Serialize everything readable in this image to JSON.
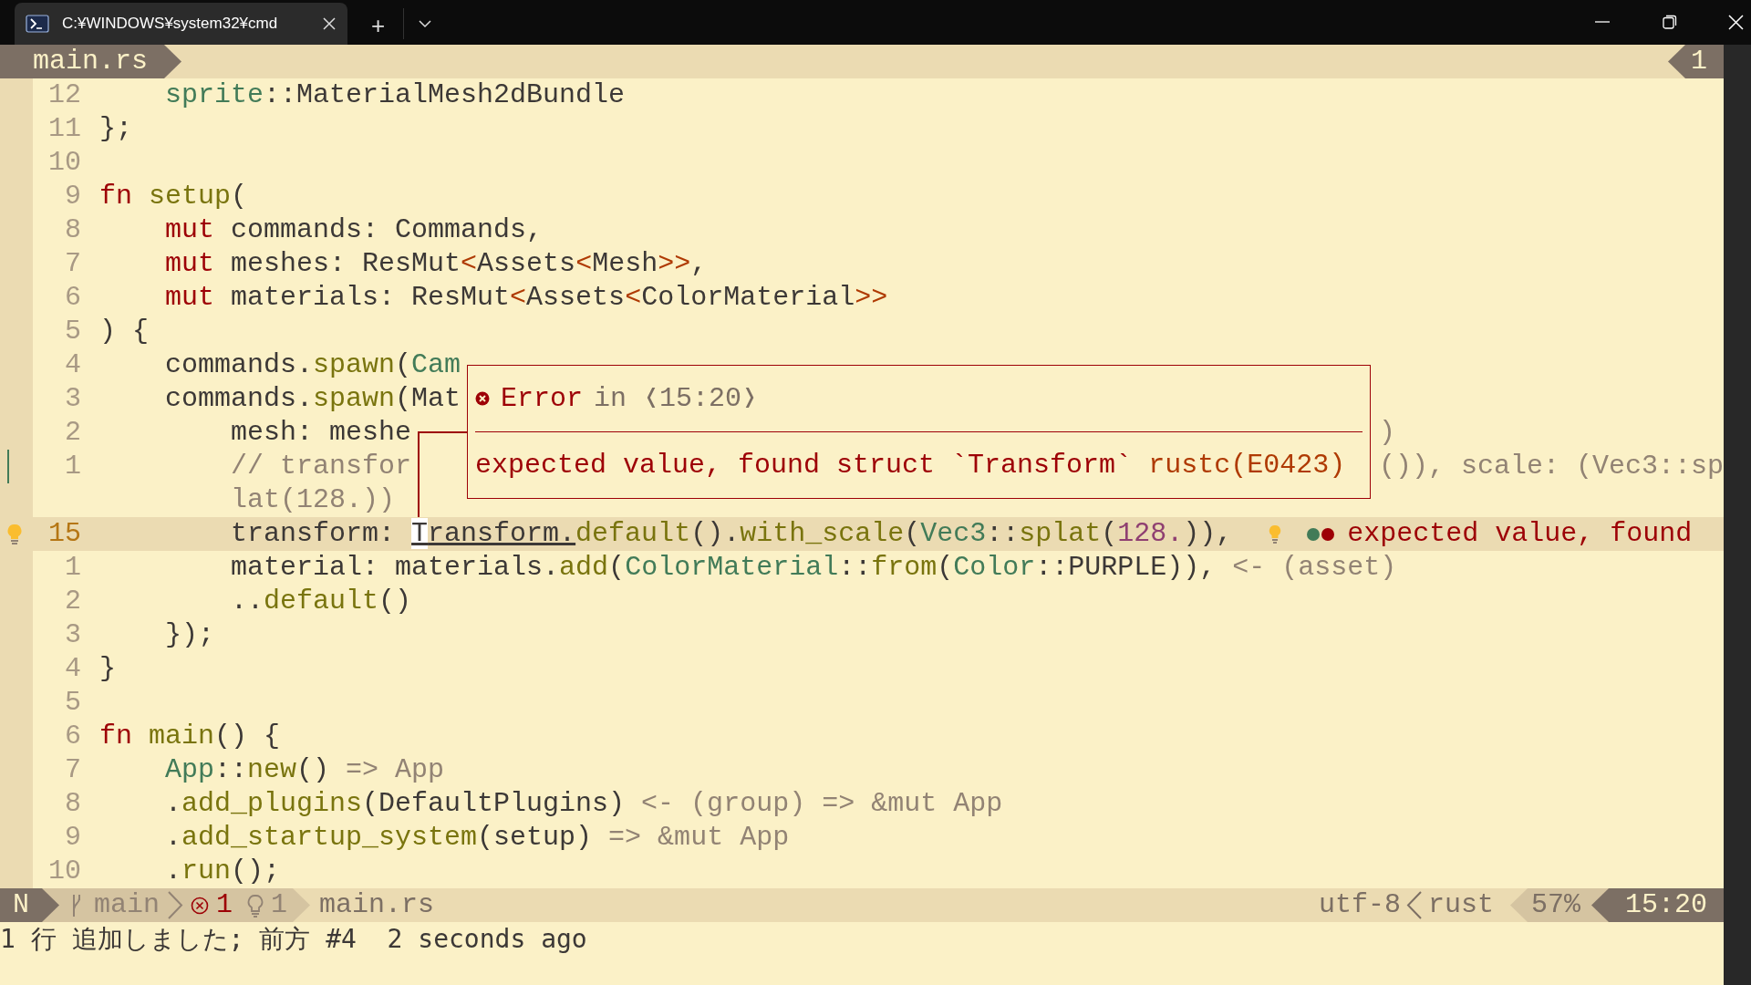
{
  "window": {
    "tab_title": "C:¥WINDOWS¥system32¥cmd",
    "new_tab": "+"
  },
  "tabline": {
    "file": "main.rs",
    "tab_number": "1"
  },
  "lines": [
    {
      "number": "12",
      "current": false,
      "git_changed": false,
      "lightbulb": false,
      "tokens": [
        {
          "text": "    sprite",
          "kind": "type"
        },
        {
          "text": "::MaterialMesh2dBundle",
          "kind": "plain"
        }
      ]
    },
    {
      "number": "11",
      "current": false,
      "git_changed": false,
      "lightbulb": false,
      "tokens": [
        {
          "text": "};",
          "kind": "plain"
        }
      ]
    },
    {
      "number": "10",
      "current": false,
      "git_changed": false,
      "lightbulb": false
    },
    {
      "number": "9",
      "current": false,
      "git_changed": false,
      "lightbulb": false,
      "tokens": [
        {
          "text": "fn",
          "kind": "keyword"
        },
        {
          "text": " setup",
          "kind": "function"
        },
        {
          "text": "(",
          "kind": "plain"
        }
      ]
    },
    {
      "number": "8",
      "current": false,
      "git_changed": false,
      "lightbulb": false,
      "tokens": [
        {
          "text": "    mut",
          "kind": "keyword"
        },
        {
          "text": " commands: Commands,",
          "kind": "plain"
        }
      ]
    },
    {
      "number": "7",
      "current": false,
      "git_changed": false,
      "lightbulb": false,
      "tokens": [
        {
          "text": "    mut",
          "kind": "keyword"
        },
        {
          "text": " meshes: ResMut",
          "kind": "plain"
        },
        {
          "text": "<",
          "kind": "bracket"
        },
        {
          "text": "Assets",
          "kind": "plain"
        },
        {
          "text": "<",
          "kind": "bracket"
        },
        {
          "text": "Mesh",
          "kind": "plain"
        },
        {
          "text": ">>",
          "kind": "bracket"
        },
        {
          "text": ",",
          "kind": "plain"
        }
      ]
    },
    {
      "number": "6",
      "current": false,
      "git_changed": false,
      "lightbulb": false,
      "tokens": [
        {
          "text": "    mut",
          "kind": "keyword"
        },
        {
          "text": " materials: ResMut",
          "kind": "plain"
        },
        {
          "text": "<",
          "kind": "bracket"
        },
        {
          "text": "Assets",
          "kind": "plain"
        },
        {
          "text": "<",
          "kind": "bracket"
        },
        {
          "text": "ColorMaterial",
          "kind": "plain"
        },
        {
          "text": ">>",
          "kind": "bracket"
        }
      ]
    },
    {
      "number": "5",
      "current": false,
      "git_changed": false,
      "lightbulb": false,
      "tokens": [
        {
          "text": ") {",
          "kind": "plain"
        }
      ]
    },
    {
      "number": "4",
      "current": false,
      "git_changed": false,
      "lightbulb": false,
      "tokens": [
        {
          "text": "    commands.",
          "kind": "plain"
        },
        {
          "text": "spawn",
          "kind": "function"
        },
        {
          "text": "(",
          "kind": "plain"
        },
        {
          "text": "Cam",
          "kind": "type"
        }
      ]
    },
    {
      "number": "3",
      "current": false,
      "git_changed": false,
      "lightbulb": false,
      "tokens": [
        {
          "text": "    commands.",
          "kind": "plain"
        },
        {
          "text": "spawn",
          "kind": "function"
        },
        {
          "text": "(Mat",
          "kind": "plain"
        }
      ]
    },
    {
      "number": "2",
      "current": false,
      "git_changed": false,
      "lightbulb": false,
      "tokens": [
        {
          "text": "        mesh: meshe",
          "kind": "plain"
        }
      ],
      "after_popup": [
        {
          "text": ")",
          "kind": "hint"
        }
      ]
    },
    {
      "number": "1",
      "current": false,
      "git_changed": true,
      "lightbulb": false,
      "tokens": [
        {
          "text": "        // transfor",
          "kind": "hint"
        }
      ],
      "after_popup": [
        {
          "text": "()), scale: (Vec3::sp",
          "kind": "hint"
        }
      ],
      "wrap": [
        {
          "text": "        lat(128.))",
          "kind": "hint"
        }
      ]
    },
    {
      "number": "15",
      "current": true,
      "git_changed": false,
      "lightbulb": true,
      "tokens": [
        {
          "text": "        transform: ",
          "kind": "plain"
        },
        {
          "text": "T",
          "kind": "cursor"
        },
        {
          "text": "ransform.",
          "kind": "underlined"
        },
        {
          "text": "default",
          "kind": "function"
        },
        {
          "text": "().",
          "kind": "plain"
        },
        {
          "text": "with_scale",
          "kind": "function"
        },
        {
          "text": "(",
          "kind": "plain"
        },
        {
          "text": "Vec3",
          "kind": "type"
        },
        {
          "text": "::",
          "kind": "plain"
        },
        {
          "text": "splat",
          "kind": "function"
        },
        {
          "text": "(",
          "kind": "plain"
        },
        {
          "text": "128.",
          "kind": "number"
        },
        {
          "text": ")),",
          "kind": "plain"
        }
      ],
      "virtual": {
        "dots": [
          {
            "color": "#427b58"
          },
          {
            "color": "#9d0006"
          }
        ],
        "text": "expected value, found"
      }
    },
    {
      "number": "1",
      "current": false,
      "git_changed": false,
      "lightbulb": false,
      "tokens": [
        {
          "text": "        material: materials.",
          "kind": "plain"
        },
        {
          "text": "add",
          "kind": "function"
        },
        {
          "text": "(",
          "kind": "plain"
        },
        {
          "text": "ColorMaterial",
          "kind": "type"
        },
        {
          "text": "::",
          "kind": "plain"
        },
        {
          "text": "from",
          "kind": "function"
        },
        {
          "text": "(",
          "kind": "plain"
        },
        {
          "text": "Color",
          "kind": "type"
        },
        {
          "text": "::PURPLE)),",
          "kind": "plain"
        },
        {
          "text": " <- (asset)",
          "kind": "hint"
        }
      ]
    },
    {
      "number": "2",
      "current": false,
      "git_changed": false,
      "lightbulb": false,
      "tokens": [
        {
          "text": "        ..",
          "kind": "plain"
        },
        {
          "text": "default",
          "kind": "function"
        },
        {
          "text": "()",
          "kind": "plain"
        }
      ]
    },
    {
      "number": "3",
      "current": false,
      "git_changed": false,
      "lightbulb": false,
      "tokens": [
        {
          "text": "    });",
          "kind": "plain"
        }
      ]
    },
    {
      "number": "4",
      "current": false,
      "git_changed": false,
      "lightbulb": false,
      "tokens": [
        {
          "text": "}",
          "kind": "plain"
        }
      ]
    },
    {
      "number": "5",
      "current": false,
      "git_changed": false,
      "lightbulb": false
    },
    {
      "number": "6",
      "current": false,
      "git_changed": false,
      "lightbulb": false,
      "tokens": [
        {
          "text": "fn",
          "kind": "keyword"
        },
        {
          "text": " main",
          "kind": "function"
        },
        {
          "text": "() {",
          "kind": "plain"
        }
      ]
    },
    {
      "number": "7",
      "current": false,
      "git_changed": false,
      "lightbulb": false,
      "tokens": [
        {
          "text": "    App",
          "kind": "type"
        },
        {
          "text": "::",
          "kind": "plain"
        },
        {
          "text": "new",
          "kind": "function"
        },
        {
          "text": "()",
          "kind": "plain"
        },
        {
          "text": " => App",
          "kind": "hint"
        }
      ]
    },
    {
      "number": "8",
      "current": false,
      "git_changed": false,
      "lightbulb": false,
      "tokens": [
        {
          "text": "    .",
          "kind": "plain"
        },
        {
          "text": "add_plugins",
          "kind": "function"
        },
        {
          "text": "(DefaultPlugins)",
          "kind": "plain"
        },
        {
          "text": " <- (group) => &mut App",
          "kind": "hint"
        }
      ]
    },
    {
      "number": "9",
      "current": false,
      "git_changed": false,
      "lightbulb": false,
      "tokens": [
        {
          "text": "    .",
          "kind": "plain"
        },
        {
          "text": "add_startup_system",
          "kind": "function"
        },
        {
          "text": "(setup)",
          "kind": "plain"
        },
        {
          "text": " => &mut App",
          "kind": "hint"
        }
      ]
    },
    {
      "number": "10",
      "current": false,
      "git_changed": false,
      "lightbulb": false,
      "tokens": [
        {
          "text": "    .",
          "kind": "plain"
        },
        {
          "text": "run",
          "kind": "function"
        },
        {
          "text": "();",
          "kind": "plain"
        }
      ]
    }
  ],
  "popup": {
    "title": "Error",
    "location": "in ❬15:20❭",
    "message": "expected value, found struct `Transform`",
    "code": "rustc(E0423)"
  },
  "statusline": {
    "mode": "N",
    "branch": "main",
    "errors": "1",
    "hints": "1",
    "file": "main.rs",
    "encoding": "utf-8",
    "filetype": "rust",
    "percent": "57%",
    "position": "15:20"
  },
  "cmdline": "1 行 追加しました; 前方 #4  2 seconds ago"
}
